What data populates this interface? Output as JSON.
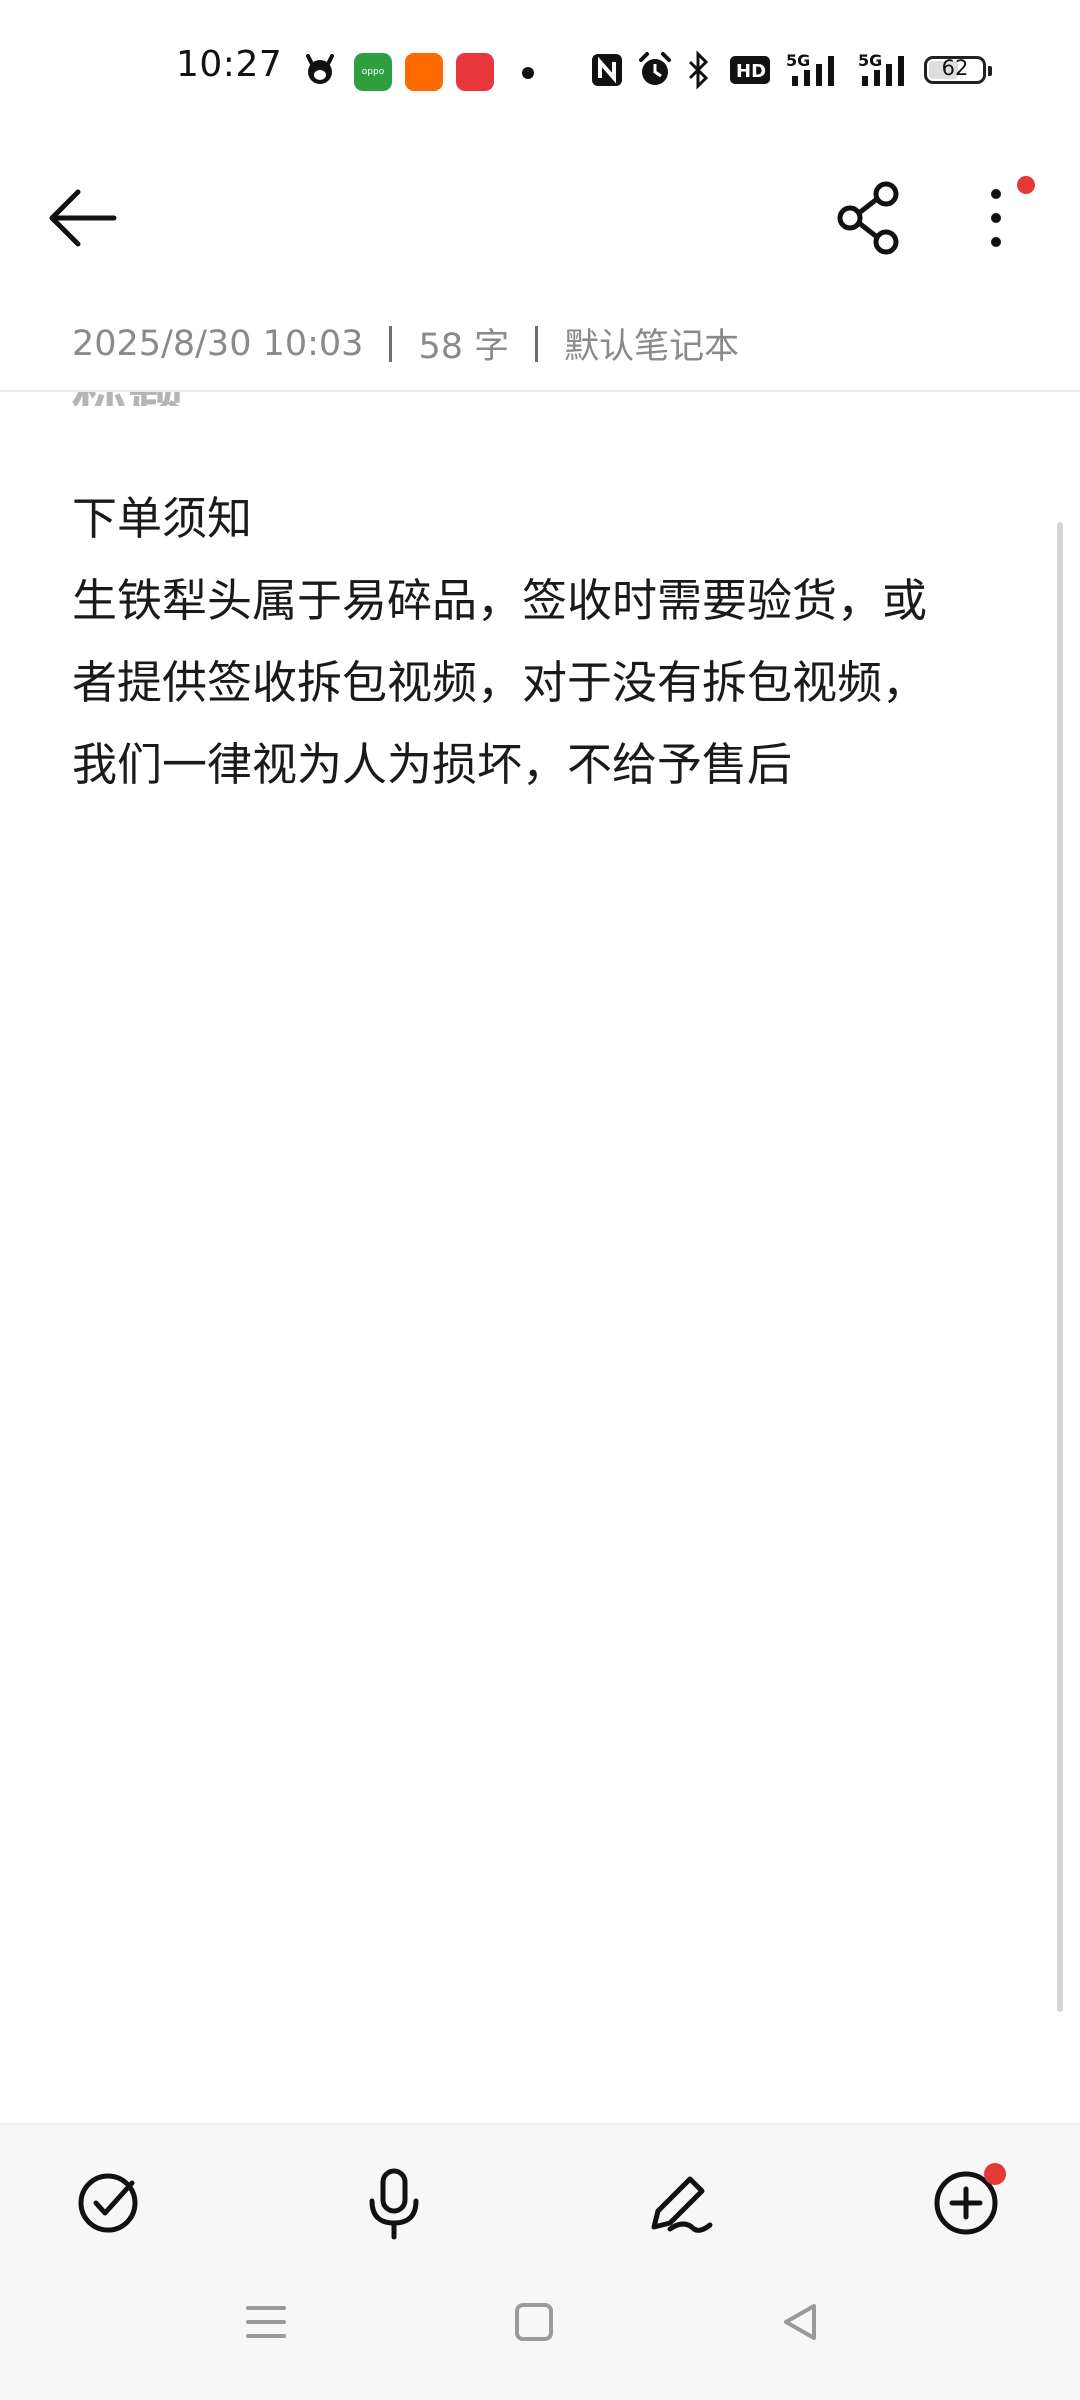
{
  "status_bar": {
    "time": "10:27",
    "battery": "62",
    "icons": [
      "cow-app-icon",
      "oppo-store-icon",
      "orange-app-icon",
      "red-app-icon",
      "dot-icon",
      "nfc-icon",
      "alarm-icon",
      "bluetooth-icon",
      "hd-icon",
      "5g-signal-icon",
      "5g-signal-icon-2"
    ]
  },
  "header": {
    "back": "back-arrow-icon",
    "share": "share-icon",
    "more": "more-vertical-icon"
  },
  "meta": {
    "date": "2025/8/30 10:03",
    "word_count": "58 字",
    "notebook": "默认笔记本"
  },
  "note": {
    "title_remnant": "标题",
    "lines": [
      "下单须知",
      "生铁犁头属于易碎品，签收时需要验货，或",
      "者提供签收拆包视频，对于没有拆包视频，",
      "我们一律视为人为损坏，不给予售后"
    ]
  },
  "toolbar": {
    "items": [
      "checklist-icon",
      "microphone-icon",
      "pen-icon",
      "add-icon"
    ]
  },
  "colors": {
    "accent_red": "#e53935",
    "text": "#1a1a1a",
    "meta_text": "#8a8a8a",
    "toolbar_bg": "#f7f7f7"
  }
}
